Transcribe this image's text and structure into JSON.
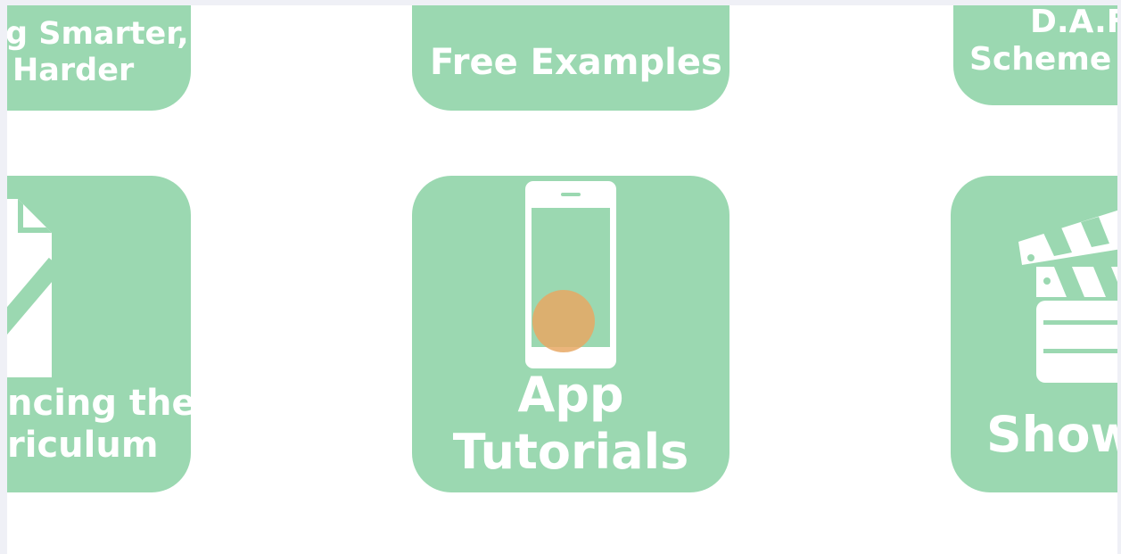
{
  "tiles": {
    "top_left": {
      "label_line1": "g Smarter,",
      "label_line2": "Harder"
    },
    "top_center": {
      "label": "Free Examples"
    },
    "top_right": {
      "label_line1": "D.A.F",
      "label_line2": "Scheme c"
    },
    "bottom_left": {
      "label_line1": "ncing the",
      "label_line2": "riculum"
    },
    "bottom_center": {
      "label_line1": "App",
      "label_line2": "Tutorials"
    },
    "bottom_right": {
      "label": "Show"
    }
  },
  "icons": {
    "bottom_left": "document-check-icon",
    "bottom_center": "smartphone-icon",
    "bottom_right": "clapperboard-icon"
  },
  "colors": {
    "tile": "#9bd8b1",
    "text": "#ffffff",
    "page_bg": "#ffffff",
    "frame_bg": "#eff0f6",
    "cursor": "#e8a864"
  }
}
